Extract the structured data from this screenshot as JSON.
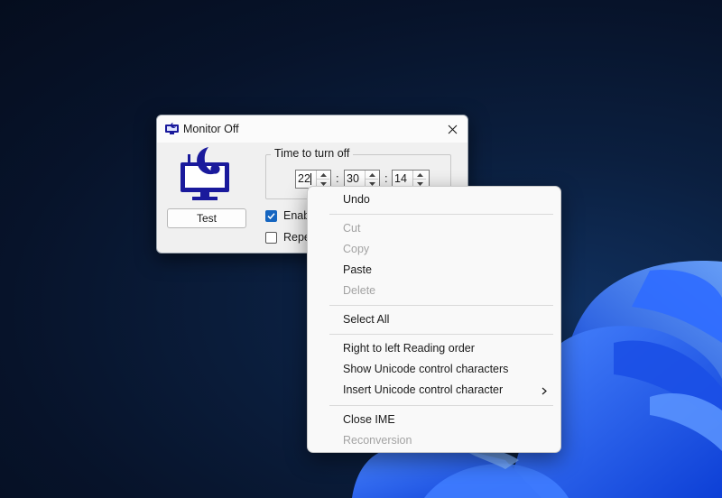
{
  "window": {
    "title": "Monitor Off",
    "icon": "monitor-moon-icon",
    "close_icon": "close-icon"
  },
  "main": {
    "big_icon": "monitor-moon-icon",
    "test_label": "Test",
    "group_label": "Time to turn off",
    "time": {
      "hours": "22",
      "minutes": "30",
      "seconds": "14",
      "separator": ":"
    },
    "enable_label": "Enab",
    "enable_checked": true,
    "repeat_label": "Repe",
    "repeat_checked": false
  },
  "context_menu": {
    "undo": "Undo",
    "cut": "Cut",
    "copy": "Copy",
    "paste": "Paste",
    "delete": "Delete",
    "select_all": "Select All",
    "rtl": "Right to left Reading order",
    "show_unicode": "Show Unicode control characters",
    "insert_unicode": "Insert Unicode control character",
    "close_ime": "Close IME",
    "reconversion": "Reconversion"
  },
  "colors": {
    "accent": "#1565c0",
    "icon_blue": "#1a1a9c",
    "disabled_text": "#a3a3a3",
    "desktop": "#07132a"
  }
}
